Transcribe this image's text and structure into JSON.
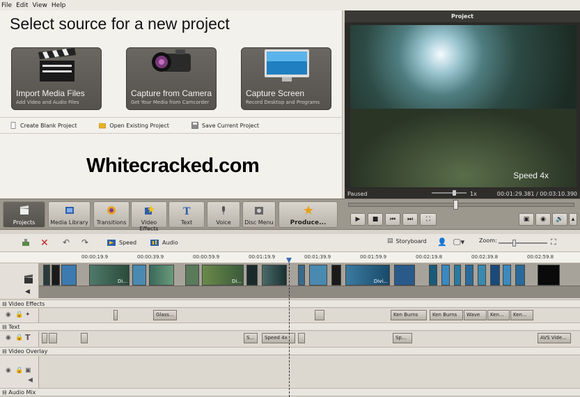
{
  "menu": [
    "File",
    "Edit",
    "View",
    "Help"
  ],
  "source": {
    "title": "Select source for a new project",
    "buttons": [
      {
        "label": "Import Media Files",
        "sub": "Add Video and Audio Files",
        "icon": "clapperboard-icon"
      },
      {
        "label": "Capture from Camera",
        "sub": "Get Your Media from Camcorder",
        "icon": "camcorder-icon"
      },
      {
        "label": "Capture Screen",
        "sub": "Record Desktop and Programs",
        "icon": "monitor-icon"
      }
    ],
    "links": [
      "Create Blank Project",
      "Open Existing Project",
      "Save Current Project"
    ]
  },
  "watermark": "Whitecracked.com",
  "preview": {
    "title": "Project",
    "overlay": "Speed 4x",
    "status": "Paused",
    "ratio": "1x",
    "time": "00:01:29.381 / 00:03:10.390"
  },
  "toolbar": {
    "tools": [
      "Projects",
      "Media Library",
      "Transitions",
      "Video Effects",
      "Text",
      "Voice",
      "Disc Menu",
      "Produce..."
    ]
  },
  "editbar": {
    "speed": "Speed",
    "audio": "Audio",
    "storyboard": "Storyboard",
    "zoom": "Zoom:"
  },
  "ruler": [
    "00:00:19.9",
    "00:00:39.9",
    "00:00:59.9",
    "00:01:19.9",
    "00:01:39.9",
    "00:01:59.9",
    "00:02:19.8",
    "00:02:39.8",
    "00:02:59.8"
  ],
  "clips": [
    "Di...",
    "Di...",
    "Divi..."
  ],
  "sections": {
    "video_effects": "Video Effects",
    "text": "Text",
    "video_overlay": "Video Overlay",
    "audio_mix": "Audio Mix"
  },
  "effects": [
    "Glass...",
    "Ken Burns",
    "Ken Burns",
    "Wave",
    "Ken...",
    "Ken..."
  ],
  "texts": [
    "S...",
    "Speed 4x",
    "Sp...",
    "AVS Vide..."
  ]
}
